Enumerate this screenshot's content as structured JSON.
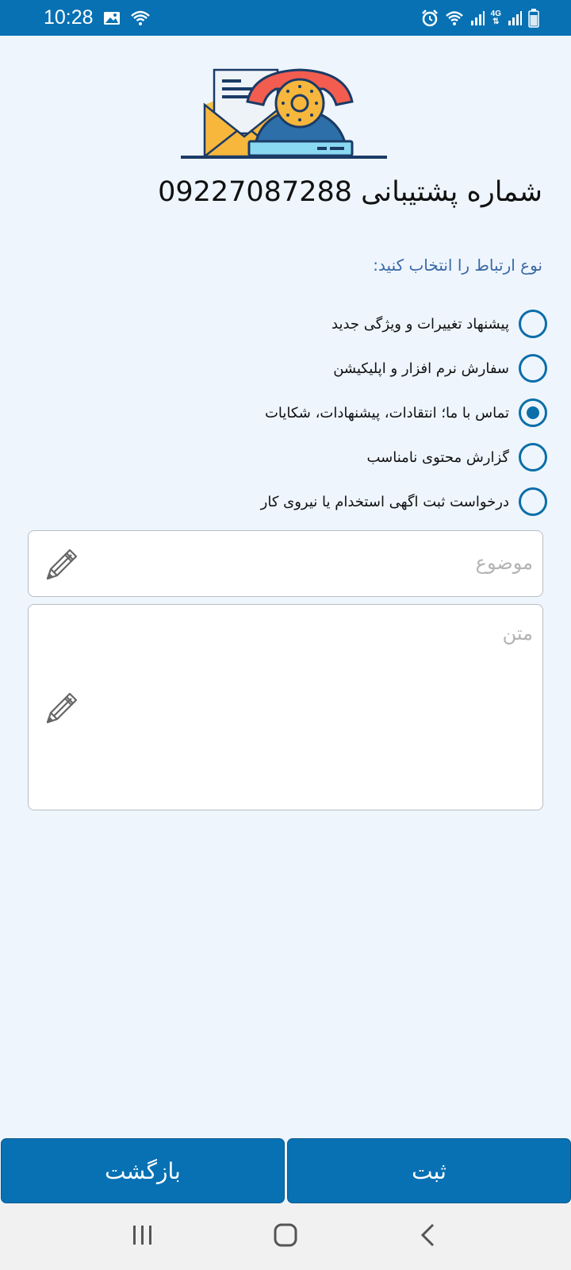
{
  "status_bar": {
    "time": "10:28",
    "network": "4G"
  },
  "header": {
    "support_prefix": "شماره پشتیبانی",
    "support_number": "09227087288"
  },
  "form": {
    "type_label": "نوع ارتباط را انتخاب کنید:",
    "options": [
      {
        "label": "پیشنهاد تغییرات و ویژگی جدید",
        "checked": false
      },
      {
        "label": "سفارش نرم افزار و اپلیکیشن",
        "checked": false
      },
      {
        "label": "تماس با ما؛ انتقادات، پیشنهادات، شکایات",
        "checked": true
      },
      {
        "label": "گزارش محتوی نامناسب",
        "checked": false
      },
      {
        "label": "درخواست ثبت اگهی استخدام یا نیروی کار",
        "checked": false
      }
    ],
    "subject_placeholder": "موضوع",
    "body_placeholder": "متن"
  },
  "buttons": {
    "submit": "ثبت",
    "back": "بازگشت"
  },
  "colors": {
    "primary": "#0771b4",
    "background": "#eef5fd",
    "radio": "#0b6ea8"
  }
}
